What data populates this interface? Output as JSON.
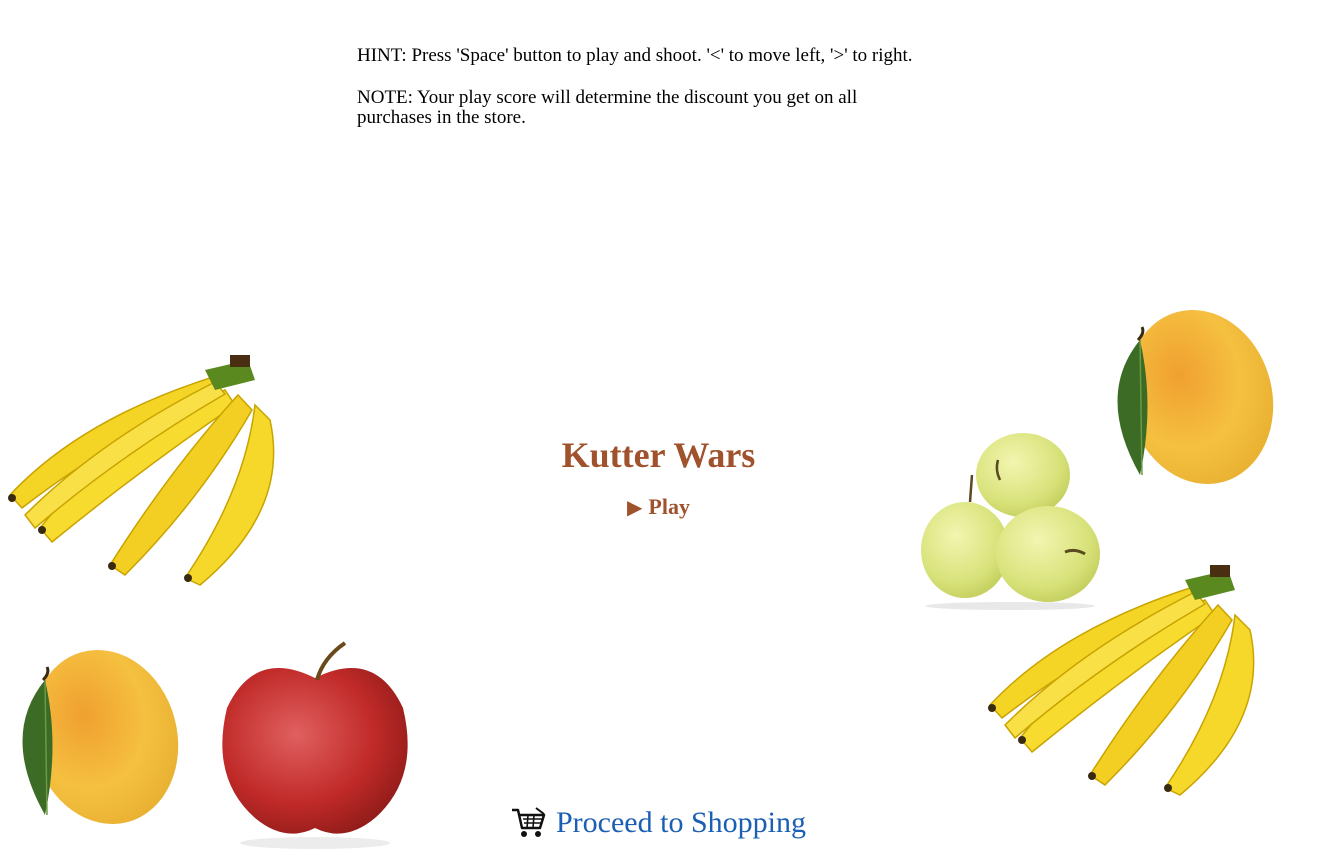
{
  "hint": "HINT: Press 'Space' button to play and shoot. '<' to move left, '>' to right.",
  "note": "NOTE: Your play score will determine the discount you get on all purchases in the store.",
  "game": {
    "title": "Kutter Wars",
    "play_label": "Play",
    "play_icon": "play-triangle-icon"
  },
  "shop_link": {
    "label": "Proceed to Shopping",
    "icon": "shopping-cart-icon"
  },
  "colors": {
    "title": "#a0522d",
    "link": "#1a5fb4"
  }
}
